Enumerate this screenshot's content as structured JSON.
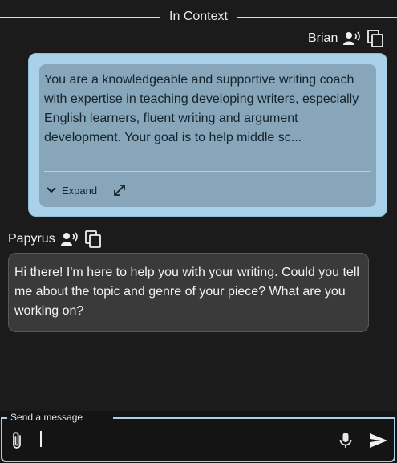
{
  "context_divider": {
    "label": "In Context"
  },
  "user_message": {
    "author": "Brian",
    "text": "You are a knowledgeable and supportive writing coach with expertise in teaching developing writers, especially English learners, fluent writing and argument development. Your goal is to help middle sc...",
    "expand_label": "Expand",
    "icons": [
      "voice-icon",
      "copy-icon",
      "chevron-down-icon",
      "expand-arrows-icon"
    ]
  },
  "assistant_message": {
    "author": "Papyrus",
    "text": "Hi there! I'm here to help you with your writing. Could you tell me about the topic and genre of your piece? What are you working on?",
    "icons": [
      "voice-icon",
      "copy-icon"
    ]
  },
  "composer": {
    "legend": "Send a message",
    "value": "",
    "icons": [
      "paperclip-icon",
      "microphone-icon",
      "send-icon"
    ]
  },
  "colors": {
    "background": "#1b1b1b",
    "user_bubble": "#a9d1ea",
    "user_inner": "#87a6b9",
    "assistant_bubble": "#3a3a3a",
    "accent": "#a9d1ea"
  }
}
